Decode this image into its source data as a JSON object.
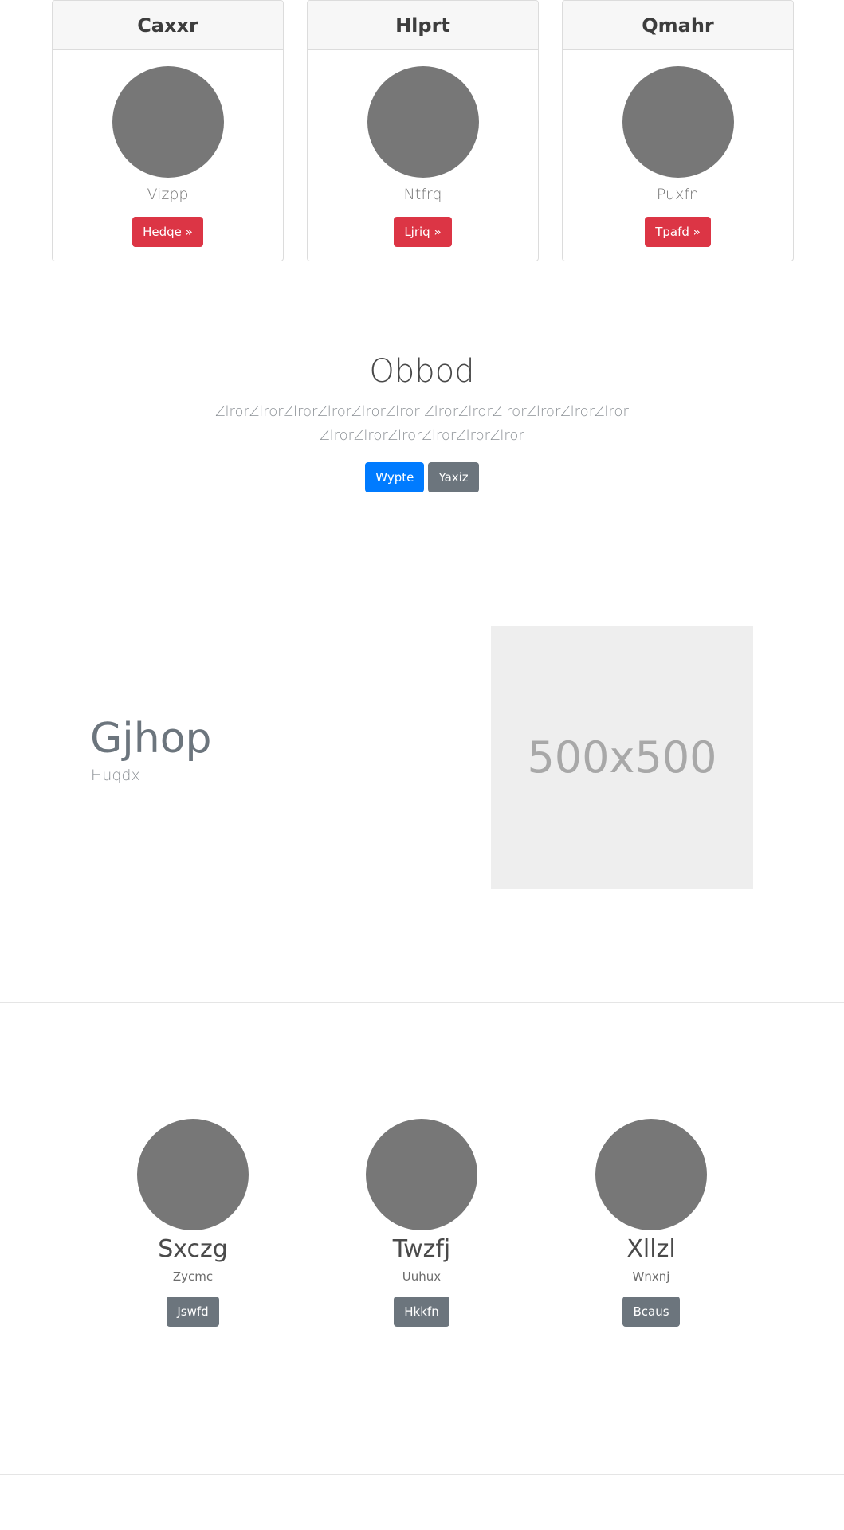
{
  "cards": [
    {
      "title": "Caxxr",
      "subtitle": "Vizpp",
      "button": "Hedqe »"
    },
    {
      "title": "Hlprt",
      "subtitle": "Ntfrq",
      "button": "Ljriq »"
    },
    {
      "title": "Qmahr",
      "subtitle": "Puxfn",
      "button": "Tpafd »"
    }
  ],
  "hero": {
    "title": "Obbod",
    "lead": "ZlrorZlrorZlrorZlrorZlrorZlror ZlrorZlrorZlrorZlrorZlrorZlror ZlrorZlrorZlrorZlrorZlrorZlror",
    "primary_button": "Wypte",
    "secondary_button": "Yaxiz"
  },
  "feature": {
    "title": "Gjhop",
    "subtitle": "Huqdx",
    "placeholder_text": "500x500"
  },
  "team": [
    {
      "name": "Sxczg",
      "role": "Zycmc",
      "button": "Jswfd"
    },
    {
      "name": "Twzfj",
      "role": "Uuhux",
      "button": "Hkkfn"
    },
    {
      "name": "Xllzl",
      "role": "Wnxnj",
      "button": "Bcaus"
    }
  ],
  "colors": {
    "danger": "#dc3545",
    "primary": "#007bff",
    "secondary": "#6c757d",
    "avatar": "#777777",
    "placeholder_bg": "#eeeeee"
  }
}
